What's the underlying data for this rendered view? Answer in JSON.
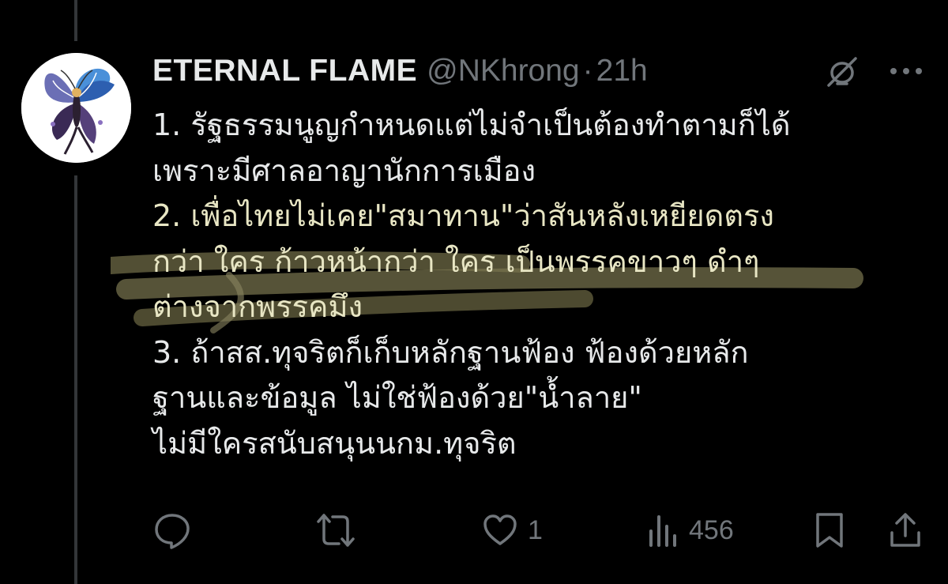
{
  "tweet": {
    "display_name": "ETERNAL FLAME",
    "handle": "@NKhrong",
    "separator": "·",
    "time": "21h",
    "lines": [
      "1. รัฐธรรมนูญกำหนดแต่ไม่จำเป็นต้องทำตามก็ได้",
      "เพราะมีศาลอาญานักการเมือง",
      "2. เพื่อไทยไม่เคย\"สมาทาน\"ว่าสันหลังเหยียดตรง",
      "กว่า ใคร ก้าวหน้ากว่า ใคร เป็นพรรคขาวๆ ดำๆ",
      "ต่างจากพรรคมึง",
      "3. ถ้าสส.ทุจริตก็เก็บหลักฐานฟ้อง ฟ้องด้วยหลัก",
      "ฐานและข้อมูล ไม่ใช่ฟ้องด้วย\"น้ำลาย\"",
      "ไม่มีใครสนับสนุนนกม.ทุจริต"
    ]
  },
  "actions": {
    "reply_count": "",
    "retweet_count": "",
    "like_count": "1",
    "views_count": "456"
  },
  "icons": {
    "mute": "mute-icon",
    "more": "more-icon",
    "reply": "reply-icon",
    "retweet": "retweet-icon",
    "like": "like-icon",
    "views": "views-icon",
    "bookmark": "bookmark-icon",
    "share": "share-icon"
  },
  "colors": {
    "background": "#000000",
    "text_primary": "#e7e9ea",
    "text_secondary": "#71767b",
    "thread_line": "#333639",
    "highlight_marker": "#d8d49a"
  }
}
